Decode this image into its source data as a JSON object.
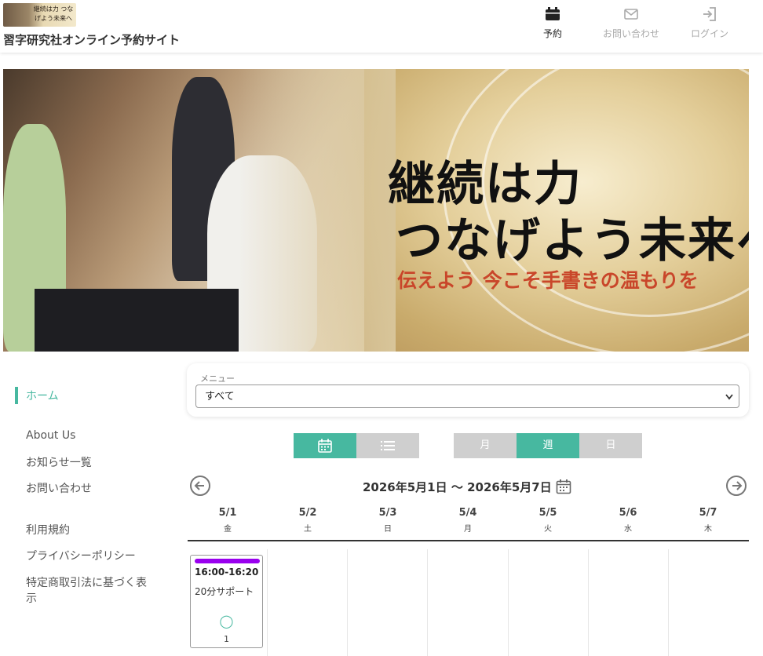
{
  "header": {
    "logo_text": "継続は力 つなげよう未来へ",
    "site_title": "習字研究社オンライン予約サイト",
    "nav": {
      "reserve": "予約",
      "contact": "お問い合わせ",
      "login": "ログイン"
    }
  },
  "banner": {
    "line1": "継続は力",
    "line2": "つなげよう未来へ",
    "tagline": "伝えよう 今こそ手書きの温もりを"
  },
  "sidebar": {
    "home": "ホーム",
    "about": "About Us",
    "news": "お知らせ一覧",
    "contact": "お問い合わせ",
    "terms": "利用規約",
    "privacy": "プライバシーポリシー",
    "tokushoho_line1": "特定商取引法に基づく表",
    "tokushoho_line2": "示"
  },
  "menu": {
    "label": "メニュー",
    "selected": "すべて"
  },
  "view": {
    "month": "月",
    "week": "週",
    "day": "日"
  },
  "calendar": {
    "range": "2026年5月1日 〜 2026年5月7日",
    "days": [
      {
        "date": "5/1",
        "weekday": "金"
      },
      {
        "date": "5/2",
        "weekday": "土"
      },
      {
        "date": "5/3",
        "weekday": "日"
      },
      {
        "date": "5/4",
        "weekday": "月"
      },
      {
        "date": "5/5",
        "weekday": "火"
      },
      {
        "date": "5/6",
        "weekday": "水"
      },
      {
        "date": "5/7",
        "weekday": "木"
      }
    ],
    "event": {
      "time": "16:00-16:20",
      "title": "20分サポート",
      "availability_mark": "◯",
      "count": "1",
      "color": "#9900ee"
    }
  },
  "colors": {
    "accent": "#47b8a0",
    "inactive": "#cfcfcf"
  }
}
